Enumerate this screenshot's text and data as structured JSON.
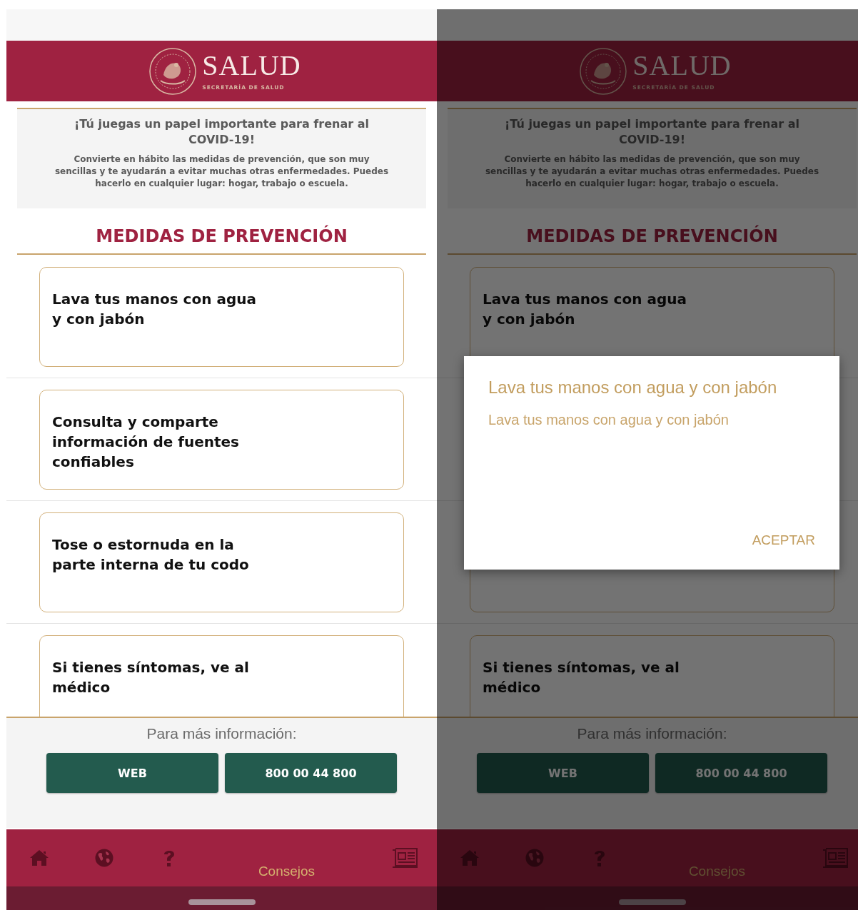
{
  "screens": [
    {
      "header": {
        "title": "SALUD",
        "subtitle": "SECRETARÍA DE SALUD"
      },
      "intro": {
        "heading": "¡Tú juegas un papel importante para frenar al\nCOVID-19!",
        "text": "Convierte en hábito las medidas de prevención, que son muy\nsencillas y te ayudarán a evitar muchas otras enfermedades. Puedes\nhacerlo en cualquier lugar: hogar, trabajo o escuela."
      },
      "section_title": "MEDIDAS DE PREVENCIÓN",
      "cards": [
        {
          "kind": "text",
          "text": "Lava tus manos con agua\ny con jabón"
        },
        {
          "kind": "text",
          "text": "Consulta y comparte\ninformación de fuentes\nconfiables"
        },
        {
          "kind": "text",
          "text": "Tose o estornuda en la\nparte interna de tu codo"
        },
        {
          "kind": "text",
          "text": "Si tienes síntomas, ve al\nmédico"
        }
      ],
      "footer": {
        "label": "Para más información:",
        "buttons": [
          "WEB",
          "800 00 44 800"
        ]
      },
      "nav": [
        {
          "kind": "home",
          "selected": false
        },
        {
          "kind": "globe",
          "selected": false
        },
        {
          "kind": "help",
          "selected": false
        },
        {
          "kind": "label",
          "label": "Consejos",
          "selected": true
        },
        {
          "kind": "news",
          "selected": false
        }
      ],
      "dimmed": false
    },
    {
      "header": {
        "title": "SALUD",
        "subtitle": "SECRETARÍA DE SALUD"
      },
      "intro": {
        "heading": "¡Tú juegas un papel importante para frenar al\nCOVID-19!",
        "text": "Convierte en hábito las medidas de prevención, que son muy\nsencillas y te ayudarán a evitar muchas otras enfermedades. Puedes\nhacerlo en cualquier lugar: hogar, trabajo o escuela."
      },
      "section_title": "MEDIDAS DE PREVENCIÓN",
      "cards": [
        {
          "kind": "text",
          "text": "Lava tus manos con agua\ny con jabón"
        },
        {
          "kind": "hidden"
        },
        {
          "kind": "blank"
        },
        {
          "kind": "text",
          "text": "Si tienes síntomas, ve al\nmédico"
        }
      ],
      "footer": {
        "label": "Para más información:",
        "buttons": [
          "WEB",
          "800 00 44 800"
        ]
      },
      "nav": [
        {
          "kind": "home",
          "selected": false
        },
        {
          "kind": "globe",
          "selected": false
        },
        {
          "kind": "help",
          "selected": false
        },
        {
          "kind": "label",
          "label": "Consejos",
          "selected": true
        },
        {
          "kind": "news",
          "selected": false
        }
      ],
      "dimmed": true,
      "dialog": {
        "title": "Lava tus manos con agua y con jabón",
        "message": "Lava tus manos con agua y con jabón",
        "button": "ACEPTAR"
      }
    }
  ]
}
